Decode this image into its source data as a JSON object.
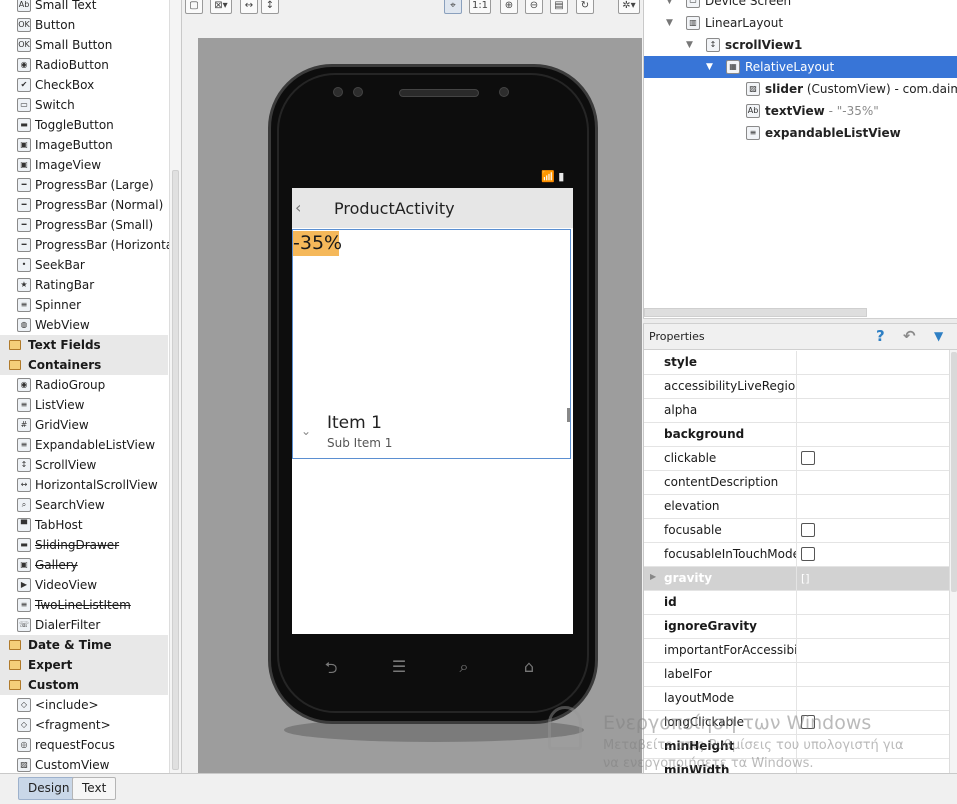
{
  "palette": {
    "widgets": [
      {
        "label": "Small Text",
        "icon": "Ab",
        "strike": false
      },
      {
        "label": "Button",
        "icon": "OK",
        "strike": false
      },
      {
        "label": "Small Button",
        "icon": "OK",
        "strike": false
      },
      {
        "label": "RadioButton",
        "icon": "◉",
        "strike": false
      },
      {
        "label": "CheckBox",
        "icon": "✔",
        "strike": false
      },
      {
        "label": "Switch",
        "icon": "▭",
        "strike": false
      },
      {
        "label": "ToggleButton",
        "icon": "▬",
        "strike": false
      },
      {
        "label": "ImageButton",
        "icon": "▣",
        "strike": false
      },
      {
        "label": "ImageView",
        "icon": "▣",
        "strike": false
      },
      {
        "label": "ProgressBar (Large)",
        "icon": "━",
        "strike": false
      },
      {
        "label": "ProgressBar (Normal)",
        "icon": "━",
        "strike": false
      },
      {
        "label": "ProgressBar (Small)",
        "icon": "━",
        "strike": false
      },
      {
        "label": "ProgressBar (Horizontal)",
        "icon": "━",
        "strike": false
      },
      {
        "label": "SeekBar",
        "icon": "•",
        "strike": false
      },
      {
        "label": "RatingBar",
        "icon": "★",
        "strike": false
      },
      {
        "label": "Spinner",
        "icon": "≡",
        "strike": false
      },
      {
        "label": "WebView",
        "icon": "◍",
        "strike": false
      }
    ],
    "categories": {
      "text_fields": "Text Fields",
      "containers": "Containers",
      "date_time": "Date & Time",
      "expert": "Expert",
      "custom": "Custom"
    },
    "containers": [
      {
        "label": "RadioGroup",
        "icon": "◉",
        "strike": false
      },
      {
        "label": "ListView",
        "icon": "≡",
        "strike": false
      },
      {
        "label": "GridView",
        "icon": "#",
        "strike": false
      },
      {
        "label": "ExpandableListView",
        "icon": "≡",
        "strike": false
      },
      {
        "label": "ScrollView",
        "icon": "↕",
        "strike": false
      },
      {
        "label": "HorizontalScrollView",
        "icon": "↔",
        "strike": false
      },
      {
        "label": "SearchView",
        "icon": "⌕",
        "strike": false
      },
      {
        "label": "TabHost",
        "icon": "▀",
        "strike": false
      },
      {
        "label": "SlidingDrawer",
        "icon": "▬",
        "strike": true
      },
      {
        "label": "Gallery",
        "icon": "▣",
        "strike": true
      },
      {
        "label": "VideoView",
        "icon": "▶",
        "strike": false
      },
      {
        "label": "TwoLineListItem",
        "icon": "≡",
        "strike": true
      },
      {
        "label": "DialerFilter",
        "icon": "☏",
        "strike": false
      }
    ],
    "custom": [
      {
        "label": "<include>",
        "icon": "◇",
        "strike": false
      },
      {
        "label": "<fragment>",
        "icon": "◇",
        "strike": false
      },
      {
        "label": "requestFocus",
        "icon": "◎",
        "strike": false
      },
      {
        "label": "CustomView",
        "icon": "▨",
        "strike": false
      }
    ]
  },
  "toolbar": {
    "icons": [
      {
        "name": "preview-screen-icon",
        "glyph": "▢"
      },
      {
        "name": "zoom-fit-dropdown-icon",
        "glyph": "⊠▾"
      },
      {
        "name": "fill-width-icon",
        "glyph": "↔"
      },
      {
        "name": "fill-height-icon",
        "glyph": "↕"
      },
      {
        "name": "pan-icon",
        "glyph": "⌖"
      },
      {
        "name": "zoom-actual-icon",
        "glyph": "1:1"
      },
      {
        "name": "zoom-in-icon",
        "glyph": "⊕"
      },
      {
        "name": "zoom-out-icon",
        "glyph": "⊖"
      },
      {
        "name": "screenshot-icon",
        "glyph": "▤"
      },
      {
        "name": "refresh-icon",
        "glyph": "↻"
      },
      {
        "name": "settings-icon",
        "glyph": "✲▾"
      }
    ]
  },
  "device": {
    "actionbar_title": "ProductActivity",
    "back_glyph": "‹",
    "slider_text": "-35%",
    "item_title": "Item 1",
    "item_subtitle": "Sub Item 1",
    "chevron_glyph": "⌄",
    "status_glyph": "📶 ▮",
    "nav": {
      "back": "⮌",
      "menu": "☰",
      "search": "⌕",
      "home": "⌂"
    }
  },
  "tree": {
    "nodes": [
      {
        "name": "Device Screen",
        "detail": "",
        "bold": false,
        "arrow": "▼",
        "icon": "▭",
        "selected": false
      },
      {
        "name": "LinearLayout",
        "detail": "",
        "bold": false,
        "arrow": "▼",
        "icon": "▥",
        "selected": false
      },
      {
        "name": "scrollView1",
        "detail": "",
        "bold": true,
        "arrow": "▼",
        "icon": "↕",
        "selected": false
      },
      {
        "name": "RelativeLayout",
        "detail": "",
        "bold": false,
        "arrow": "▼",
        "icon": "▦",
        "selected": true
      },
      {
        "name": "slider",
        "detail": " (CustomView) - com.daimajia.",
        "bold": true,
        "arrow": "",
        "icon": "▨",
        "selected": false
      },
      {
        "name": "textView",
        "detail": " - \"-35%\"",
        "bold": true,
        "arrow": "",
        "icon": "Ab",
        "selected": false
      },
      {
        "name": "expandableListView",
        "detail": "",
        "bold": true,
        "arrow": "",
        "icon": "≡",
        "selected": false
      }
    ]
  },
  "properties": {
    "title": "Properties",
    "help_glyph": "?",
    "undo_glyph": "↶",
    "filter_glyph": "▼",
    "rows": [
      {
        "name": "style",
        "value": "",
        "bold": true,
        "checkbox": false,
        "highlight": false
      },
      {
        "name": "accessibilityLiveRegion",
        "value": "",
        "bold": false,
        "checkbox": false,
        "highlight": false
      },
      {
        "name": "alpha",
        "value": "",
        "bold": false,
        "checkbox": false,
        "highlight": false
      },
      {
        "name": "background",
        "value": "",
        "bold": true,
        "checkbox": false,
        "highlight": false
      },
      {
        "name": "clickable",
        "value": "",
        "bold": false,
        "checkbox": true,
        "highlight": false
      },
      {
        "name": "contentDescription",
        "value": "",
        "bold": false,
        "checkbox": false,
        "highlight": false
      },
      {
        "name": "elevation",
        "value": "",
        "bold": false,
        "checkbox": false,
        "highlight": false
      },
      {
        "name": "focusable",
        "value": "",
        "bold": false,
        "checkbox": true,
        "highlight": false
      },
      {
        "name": "focusableInTouchMode",
        "value": "",
        "bold": false,
        "checkbox": true,
        "highlight": false
      },
      {
        "name": "gravity",
        "value": "[]",
        "bold": true,
        "checkbox": false,
        "highlight": true
      },
      {
        "name": "id",
        "value": "",
        "bold": true,
        "checkbox": false,
        "highlight": false
      },
      {
        "name": "ignoreGravity",
        "value": "",
        "bold": true,
        "checkbox": false,
        "highlight": false
      },
      {
        "name": "importantForAccessibility",
        "value": "",
        "bold": false,
        "checkbox": false,
        "highlight": false
      },
      {
        "name": "labelFor",
        "value": "",
        "bold": false,
        "checkbox": false,
        "highlight": false
      },
      {
        "name": "layoutMode",
        "value": "",
        "bold": false,
        "checkbox": false,
        "highlight": false
      },
      {
        "name": "longClickable",
        "value": "",
        "bold": false,
        "checkbox": true,
        "highlight": false
      },
      {
        "name": "minHeight",
        "value": "",
        "bold": true,
        "checkbox": false,
        "highlight": false
      },
      {
        "name": "minWidth",
        "value": "",
        "bold": true,
        "checkbox": false,
        "highlight": false
      }
    ]
  },
  "watermark": {
    "line1": "Ενεργοποίηση των Windows",
    "line2": "Μεταβείτε στις Ρυθμίσεις του υπολογιστή για",
    "line3": "να ενεργοποιήσετε τα Windows."
  },
  "bottom_tabs": [
    {
      "label": "Design",
      "active": true
    },
    {
      "label": "Text",
      "active": false
    }
  ],
  "colors": {
    "selection": "#3875d7",
    "slider_badge": "#f5b85a",
    "layout_outline": "#5b8fd1",
    "canvas_background": "#9d9d9d",
    "active_tab": "#c9d7e8"
  }
}
